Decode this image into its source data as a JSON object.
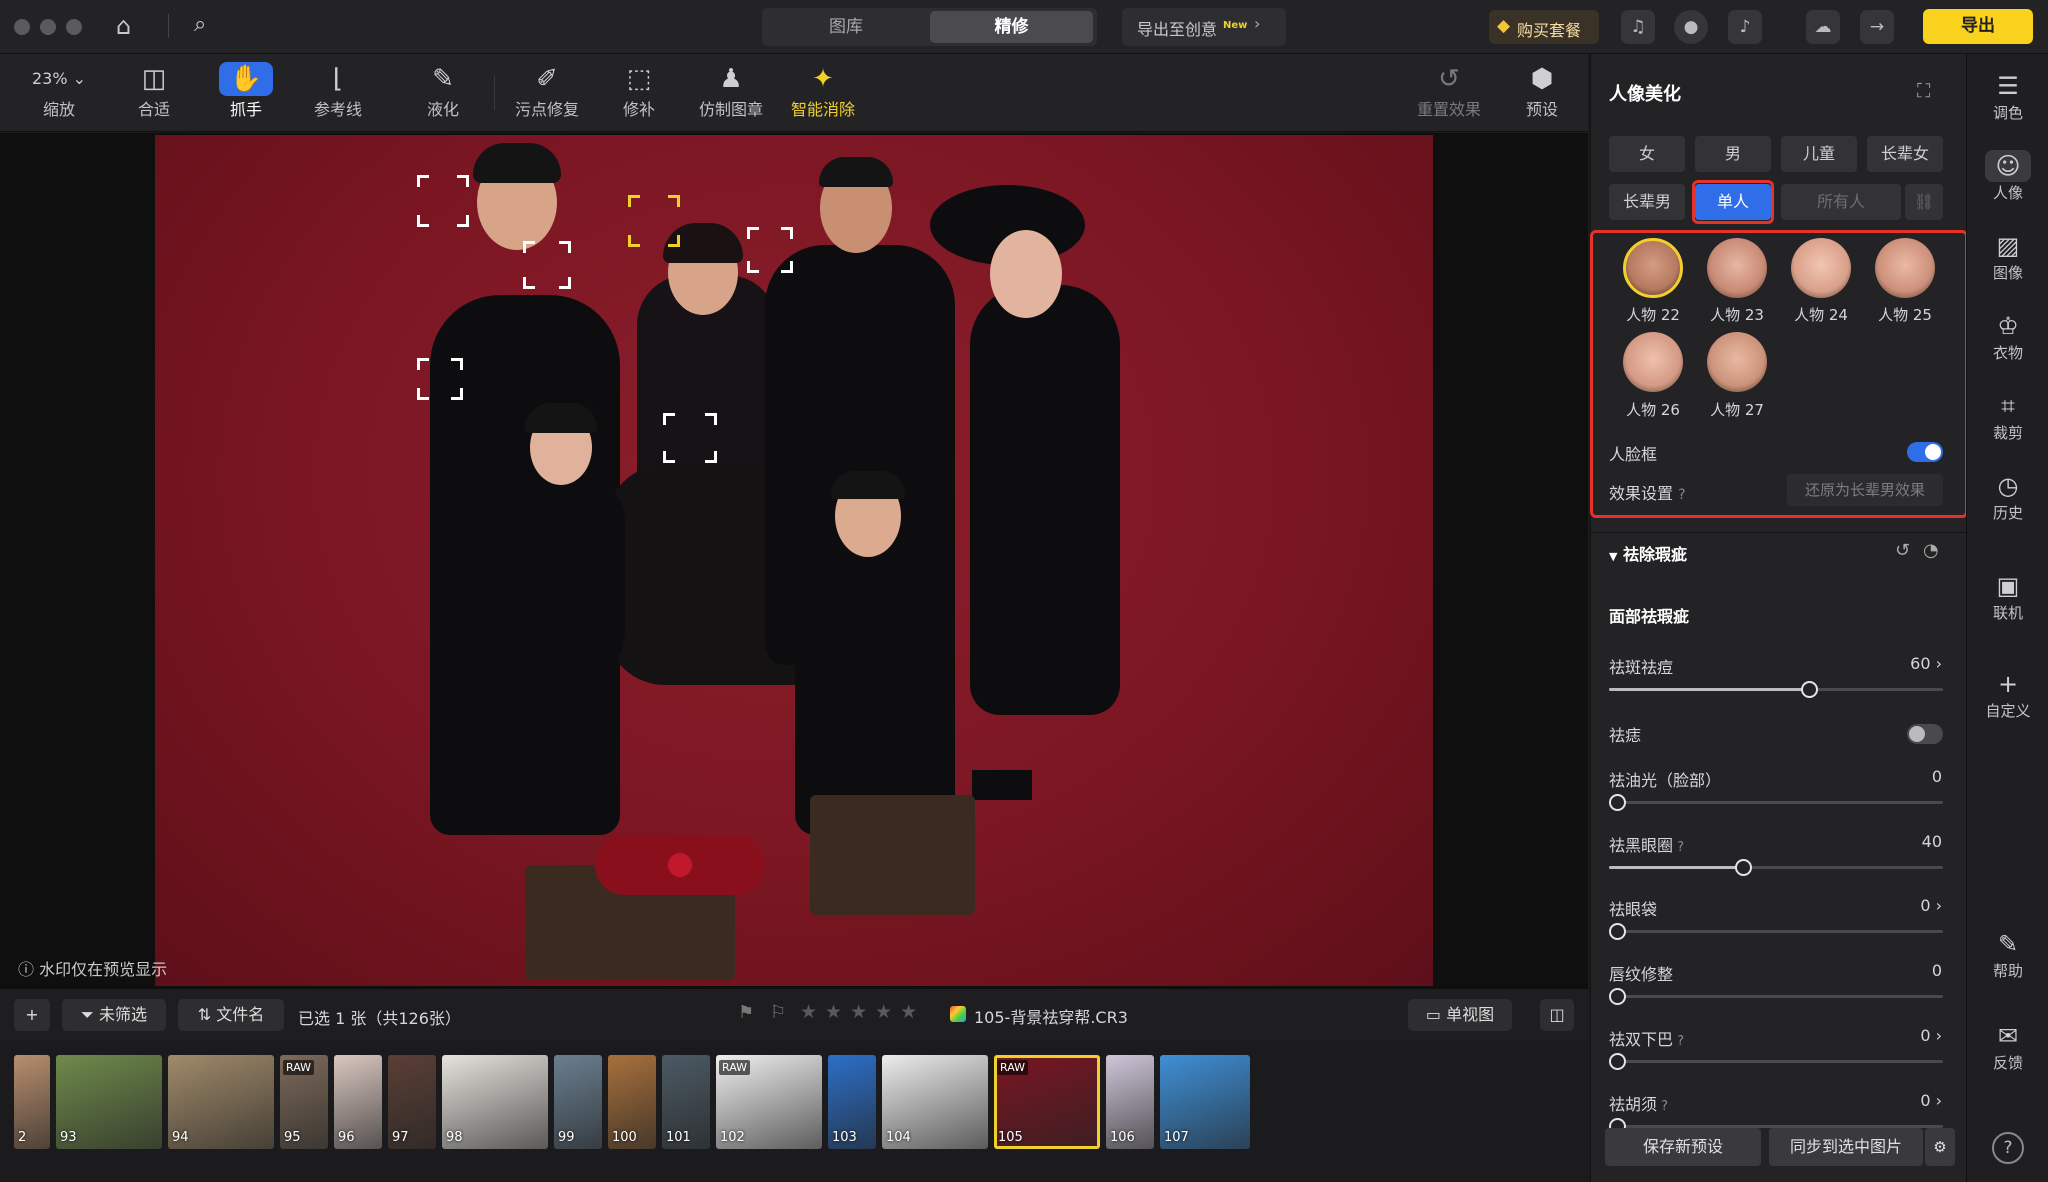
{
  "titlebar": {
    "tabs": [
      {
        "label": "图库",
        "active": false
      },
      {
        "label": "精修",
        "active": true
      }
    ],
    "export_creative": "导出至创意",
    "new_badge": "New",
    "buy_label": "购买套餐",
    "export_label": "导出"
  },
  "toolbar": {
    "zoom_value": "23%",
    "zoom_label": "缩放",
    "tools": [
      {
        "label": "合适",
        "icon": "fit-icon"
      },
      {
        "label": "抓手",
        "icon": "hand-icon",
        "active": true
      },
      {
        "label": "参考线",
        "icon": "ruler-icon"
      },
      {
        "label": "液化",
        "icon": "liquify-icon"
      },
      {
        "label": "污点修复",
        "icon": "spot-heal-icon"
      },
      {
        "label": "修补",
        "icon": "patch-icon"
      },
      {
        "label": "仿制图章",
        "icon": "stamp-icon"
      },
      {
        "label": "智能消除",
        "icon": "ai-erase-icon"
      }
    ],
    "reset_label": "重置效果",
    "preset_label": "预设"
  },
  "canvas": {
    "watermark_note": "水印仅在预览显示"
  },
  "filmbar": {
    "filter_label": "未筛选",
    "sort_label": "文件名",
    "selection_text": "已选 1 张（共126张）",
    "filename": "105-背景祛穿帮.CR3",
    "view_label": "单视图"
  },
  "filmstrip": [
    {
      "num": "2",
      "color": "#b88f6e"
    },
    {
      "num": "93",
      "color": "#6f8a4c"
    },
    {
      "num": "94",
      "color": "#a08a6a"
    },
    {
      "num": "95",
      "color": "#7d6a5a",
      "raw": "RAW"
    },
    {
      "num": "96",
      "color": "#d9c7c0"
    },
    {
      "num": "97",
      "color": "#5a3f36"
    },
    {
      "num": "98",
      "color": "#e6e2dd"
    },
    {
      "num": "99",
      "color": "#6a7f90"
    },
    {
      "num": "100",
      "color": "#a7703c"
    },
    {
      "num": "101",
      "color": "#4c5a64"
    },
    {
      "num": "102",
      "color": "#efefef",
      "raw": "RAW"
    },
    {
      "num": "103",
      "color": "#2d6fc8"
    },
    {
      "num": "104",
      "color": "#ececec"
    },
    {
      "num": "105",
      "color": "#7a1622",
      "raw": "RAW",
      "selected": true
    },
    {
      "num": "106",
      "color": "#cfc6d8"
    },
    {
      "num": "107",
      "color": "#3f8fd6"
    }
  ],
  "panel": {
    "title": "人像美化",
    "groups_row1": [
      "女",
      "男",
      "儿童",
      "长辈女"
    ],
    "groups_row2": [
      "长辈男",
      "单人",
      "所有人"
    ],
    "active_group": "单人",
    "persons": [
      "人物 22",
      "人物 23",
      "人物 24",
      "人物 25",
      "人物 26",
      "人物 27"
    ],
    "face_frame_label": "人脸框",
    "face_frame_on": true,
    "effect_label": "效果设置",
    "restore_label": "还原为长辈男效果",
    "section_title": "祛除瑕疵",
    "subsection_title": "面部祛瑕疵",
    "sliders": [
      {
        "label": "祛斑祛痘",
        "value": "60",
        "fraction": 0.6,
        "arrow": true
      },
      {
        "label": "祛痣",
        "toggle": true,
        "on": false
      },
      {
        "label": "祛油光（脸部）",
        "value": "0",
        "fraction": 0
      },
      {
        "label": "祛黑眼圈",
        "value": "40",
        "fraction": 0.4,
        "help": true
      },
      {
        "label": "祛眼袋",
        "value": "0",
        "fraction": 0,
        "arrow": true
      },
      {
        "label": "唇纹修整",
        "value": "0",
        "fraction": 0
      },
      {
        "label": "祛双下巴",
        "value": "0",
        "fraction": 0,
        "help": true,
        "arrow": true
      },
      {
        "label": "祛胡须",
        "value": "0",
        "fraction": 0,
        "help": true,
        "arrow": true
      }
    ],
    "save_preset": "保存新预设",
    "sync_label": "同步到选中图片"
  },
  "rail": [
    {
      "label": "调色",
      "icon": "adjust-icon"
    },
    {
      "label": "人像",
      "icon": "portrait-icon",
      "active": true
    },
    {
      "label": "图像",
      "icon": "image-icon"
    },
    {
      "label": "衣物",
      "icon": "clothes-icon"
    },
    {
      "label": "裁剪",
      "icon": "crop-icon"
    },
    {
      "label": "历史",
      "icon": "history-icon"
    },
    {
      "label": "联机",
      "icon": "tether-icon"
    },
    {
      "label": "自定义",
      "icon": "plus-icon"
    },
    {
      "label": "帮助",
      "icon": "help-icon"
    },
    {
      "label": "反馈",
      "icon": "feedback-icon"
    }
  ],
  "colors": {
    "accent": "#2f6de9",
    "highlight": "#f2d02a",
    "export": "#f8d21d",
    "annotation": "#e5332a"
  }
}
